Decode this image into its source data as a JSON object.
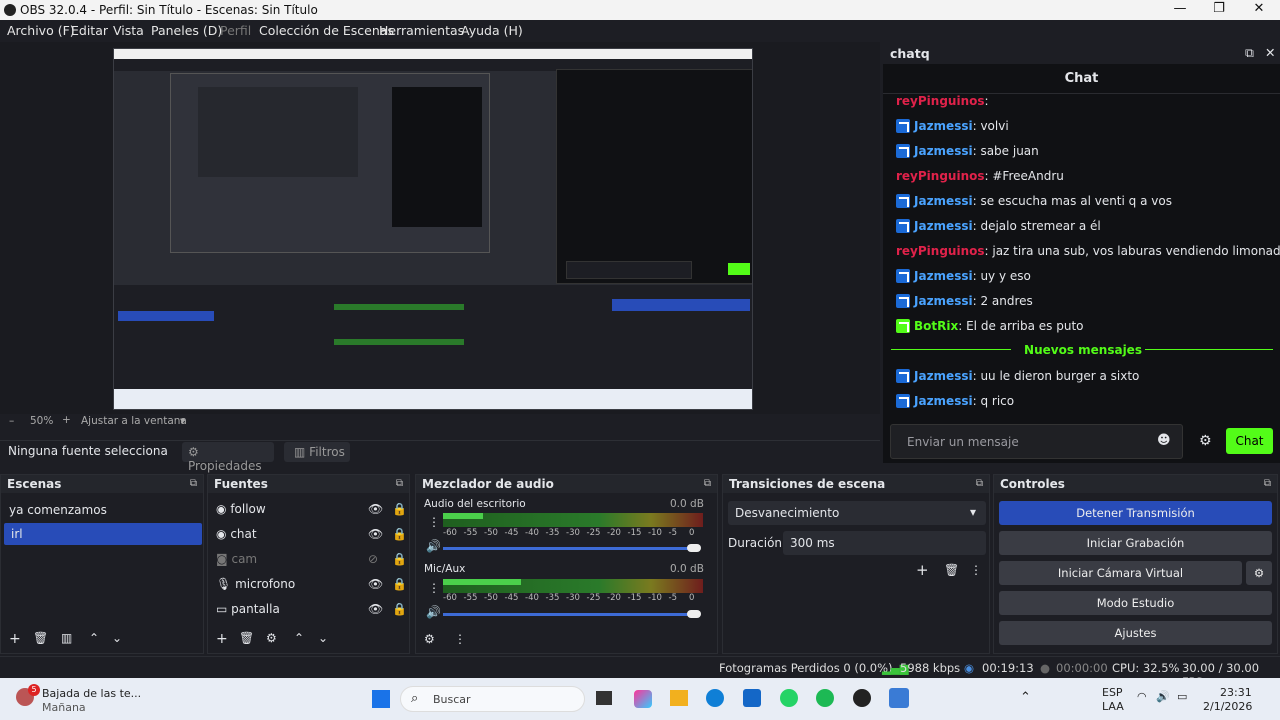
{
  "window": {
    "title": "OBS 32.0.4 - Perfil: Sin Título - Escenas: Sin Título"
  },
  "menu": [
    "Archivo (F)",
    "Editar",
    "Vista",
    "Paneles (D)",
    "Perfil",
    "Colección de Escenas",
    "Herramientas",
    "Ayuda (H)"
  ],
  "zoom": {
    "level": "50%",
    "minus": "–",
    "plus": "+",
    "fit": "Ajustar a la ventana"
  },
  "source_bar": {
    "none_selected": "Ninguna fuente selecciona",
    "properties": "Propiedades",
    "filters": "Filtros"
  },
  "chat": {
    "dock_title": "chatq",
    "title": "Chat",
    "messages": [
      {
        "name": "reyPinguinos",
        "color": "#e0224a",
        "text": ""
      },
      {
        "name": "Jazmessi",
        "color": "#4aa3ff",
        "text": "volvi"
      },
      {
        "name": "Jazmessi",
        "color": "#4aa3ff",
        "text": "sabe juan"
      },
      {
        "name": "reyPinguinos",
        "color": "#e0224a",
        "text": "#FreeAndru"
      },
      {
        "name": "Jazmessi",
        "color": "#4aa3ff",
        "text": "se escucha mas al venti q a vos"
      },
      {
        "name": "Jazmessi",
        "color": "#4aa3ff",
        "text": "dejalo stremear a él"
      },
      {
        "name": "reyPinguinos",
        "color": "#e0224a",
        "text": "jaz tira una sub, vos laburas vendiendo limonada"
      },
      {
        "name": "Jazmessi",
        "color": "#4aa3ff",
        "text": "uy y eso"
      },
      {
        "name": "Jazmessi",
        "color": "#4aa3ff",
        "text": "2 andres"
      },
      {
        "name": "BotRix",
        "color": "#53fc18",
        "text": "El de arriba es puto"
      }
    ],
    "new_messages": "Nuevos mensajes",
    "after": [
      {
        "name": "Jazmessi",
        "color": "#4aa3ff",
        "text": "uu le dieron burger a sixto"
      },
      {
        "name": "Jazmessi",
        "color": "#4aa3ff",
        "text": "q rico"
      }
    ],
    "input_placeholder": "Enviar un mensaje",
    "send_label": "Chat",
    "accent": "#53fc18"
  },
  "scenes": {
    "title": "Escenas",
    "items": [
      "ya comenzamos",
      "irl"
    ],
    "selected": "irl"
  },
  "sources": {
    "title": "Fuentes",
    "items": [
      "follow",
      "chat",
      "cam",
      "microfono",
      "pantalla"
    ]
  },
  "mixer": {
    "title": "Mezclador de audio",
    "channels": [
      {
        "name": "Audio del escritorio",
        "db": "0.0 dB"
      },
      {
        "name": "Mic/Aux",
        "db": "0.0 dB"
      }
    ],
    "ticks": [
      "-60",
      "-55",
      "-50",
      "-45",
      "-40",
      "-35",
      "-30",
      "-25",
      "-20",
      "-15",
      "-10",
      "-5",
      "0"
    ]
  },
  "transitions": {
    "title": "Transiciones de escena",
    "type": "Desvanecimiento",
    "duration_label": "Duración",
    "duration": "300 ms"
  },
  "controls": {
    "title": "Controles",
    "stop": "Detener Transmisión",
    "record": "Iniciar Grabación",
    "vcam": "Iniciar Cámara Virtual",
    "studio": "Modo Estudio",
    "settings": "Ajustes",
    "accent": "#284cb8"
  },
  "status": {
    "dropped": "Fotogramas Perdidos 0 (0.0%)",
    "kbps": "5988 kbps",
    "stream_time": "00:19:13",
    "rec_time": "00:00:00",
    "cpu": "CPU: 32.5%",
    "fps": "30.00 / 30.00 FPS"
  },
  "taskbar": {
    "weather_title": "Bajada de las te...",
    "weather_sub": "Mañana",
    "search": "Buscar",
    "lang": "ESP",
    "region": "LAA",
    "time": "23:31",
    "date": "2/1/2026",
    "notif": "5"
  }
}
